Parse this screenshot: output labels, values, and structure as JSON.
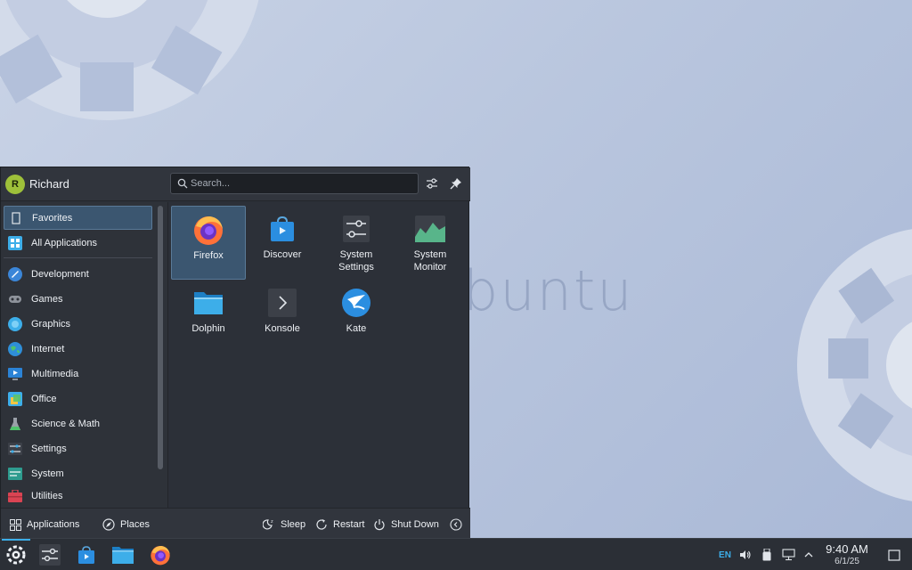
{
  "wallpaper": {
    "text": "buntu"
  },
  "launcher": {
    "user": {
      "initial": "R",
      "name": "Richard"
    },
    "search": {
      "placeholder": "Search..."
    },
    "sidebar": [
      {
        "label": "Favorites",
        "icon": "bookmark-icon",
        "active": true
      },
      {
        "label": "All Applications",
        "icon": "grid-icon",
        "active": false
      },
      {
        "label": "Development",
        "icon": "development-icon",
        "active": false
      },
      {
        "label": "Games",
        "icon": "gamepad-icon",
        "active": false
      },
      {
        "label": "Graphics",
        "icon": "graphics-icon",
        "active": false
      },
      {
        "label": "Internet",
        "icon": "globe-icon",
        "active": false
      },
      {
        "label": "Multimedia",
        "icon": "multimedia-icon",
        "active": false
      },
      {
        "label": "Office",
        "icon": "office-icon",
        "active": false
      },
      {
        "label": "Science & Math",
        "icon": "flask-icon",
        "active": false
      },
      {
        "label": "Settings",
        "icon": "settings-icon",
        "active": false
      },
      {
        "label": "System",
        "icon": "system-icon",
        "active": false
      },
      {
        "label": "Utilities",
        "icon": "toolbox-icon",
        "active": false
      }
    ],
    "apps": [
      {
        "label": "Firefox",
        "icon": "firefox-icon",
        "active": true
      },
      {
        "label": "Discover",
        "icon": "discover-icon",
        "active": false
      },
      {
        "label": "System\nSettings",
        "icon": "system-settings-icon",
        "active": false
      },
      {
        "label": "System\nMonitor",
        "icon": "system-monitor-icon",
        "active": false
      },
      {
        "label": "Dolphin",
        "icon": "dolphin-icon",
        "active": false
      },
      {
        "label": "Konsole",
        "icon": "konsole-icon",
        "active": false
      },
      {
        "label": "Kate",
        "icon": "kate-icon",
        "active": false
      }
    ],
    "footer": {
      "applications": "Applications",
      "places": "Places",
      "sleep": "Sleep",
      "restart": "Restart",
      "shutdown": "Shut Down"
    }
  },
  "taskbar": {
    "tray": {
      "keyboard_layout": "EN"
    },
    "clock": {
      "time": "9:40 AM",
      "date": "6/1/25"
    }
  },
  "colors": {
    "accent": "#3daee9",
    "panel": "#2c3038",
    "selection": "#3b5670"
  }
}
